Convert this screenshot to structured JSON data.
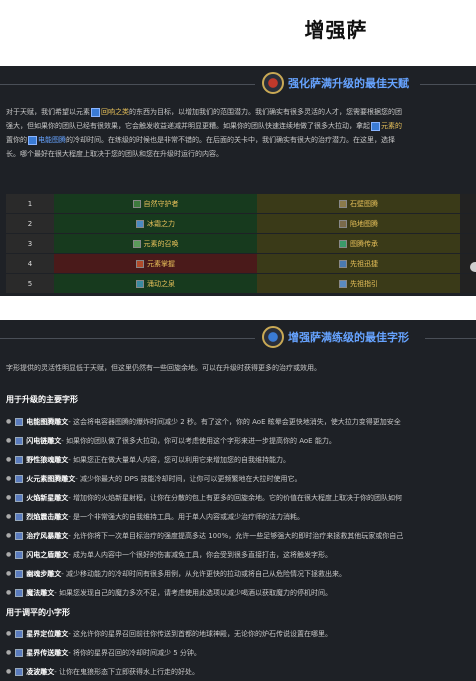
{
  "page_title": "增强萨",
  "talents_section": {
    "title": "强化萨满升级的最佳天赋",
    "para_line1_pre": "对于天赋，我们希望以元素",
    "para_line1_link": "回响之类",
    "para_line1_post": "的东西为目标，以增加我们的范围潜力。我们确实有很多灵活的人才，您需要根据您的团",
    "para_line2_pre": "强大，但如果你的团队已经有很效果，它会触发收益递减并明显更糟。如果你的团队快速连续地做了很多大拉动，拿起",
    "para_line2_link": "元素的",
    "para_line3_pre": "置你的",
    "para_line3_link": "电能图腾",
    "para_line3_post": "的冷却时间。在练级的时候也是非常不错的。在后面的关卡中，我们确实有很大的治疗潜力。在这里，选择",
    "para_line4": "长。哪个最好在很大程度上取决于您的团队和您在升级时运行的内容。",
    "rows": [
      {
        "num": "1",
        "a": "自然守护者",
        "b": "石壁图腾"
      },
      {
        "num": "2",
        "a": "冰霜之力",
        "b": "陷地图腾"
      },
      {
        "num": "3",
        "a": "元素的召唤",
        "b": "图腾传承"
      },
      {
        "num": "4",
        "a": "元素掌握",
        "b": "先祖迅捷"
      },
      {
        "num": "5",
        "a": "涌动之泉",
        "b": "先祖指引"
      }
    ]
  },
  "glyphs_section": {
    "title": "增强萨满练级的最佳字形",
    "intro": "字形提供的灵活性明显低于天赋，但这里仍然有一些回旋余地。可以在升级时获得更多的治疗或效用。",
    "major_title": "用于升级的主要字形",
    "major": [
      {
        "name": "电能图腾雕文",
        "desc": " - 这会将电容器图腾的爆炸时间减少 2 秒。有了这个，你的 AoE 眩晕会更快地消失，使大拉力变得更加安全"
      },
      {
        "name": "闪电链雕文",
        "desc": " - 如果你的团队做了很多大拉动，你可以考虑使用这个字形来进一步提高你的 AoE 能力。"
      },
      {
        "name": "野性狼魂雕文",
        "desc": " - 如果您正在做大量单人内容，您可以利用它来增加您的自我维持能力。"
      },
      {
        "name": "火元素图腾雕文",
        "desc": " - 减少你最大的 DPS 技能冷却时间，让你可以更频繁地在大拉时使用它。"
      },
      {
        "name": "火焰新星雕文",
        "desc": " - 增加你的火焰新星射程，让你在分散的包上有更多的回旋余地。它的价值在很大程度上取决于你的团队如何"
      },
      {
        "name": "烈焰震击雕文",
        "desc": " - 是一个非常强大的自我维持工具。用于单人内容或减少治疗师的法力消耗。"
      },
      {
        "name": "治疗风暴雕文",
        "desc": " - 允许你将下一次单目标治疗的强度提高多达 100%，允许一些足够强大的即时治疗来拯救其他玩家或你自己"
      },
      {
        "name": "闪电之盾雕文",
        "desc": " - 成为单人内容中一个很好的伤害减免工具，你会受到很多直接打击，这将触发字形。"
      },
      {
        "name": "幽魂步雕文",
        "desc": " - 减少移动能力的冷却时间有很多用例，从允许更快的拉动或将自己从危险情况下拯救出来。"
      },
      {
        "name": "魔法雕文",
        "desc": " - 如果您发现自己的魔力多次不足，请考虑使用此选项以减少喝酒以获取魔力的停机时间。"
      }
    ],
    "minor_title": "用于调平的小字形",
    "minor": [
      {
        "name": "星界定位雕文",
        "desc": " - 这允许你的星界召回前往你传送到首都的地球神殿，无论你的炉石传说设置在哪里。"
      },
      {
        "name": "星界传送雕文",
        "desc": " - 将你的星界召回的冷却时间减少 5 分钟。"
      },
      {
        "name": "凌波雕文",
        "desc": " - 让你在鬼狼形态下立即获得水上行走的好处。"
      }
    ]
  }
}
